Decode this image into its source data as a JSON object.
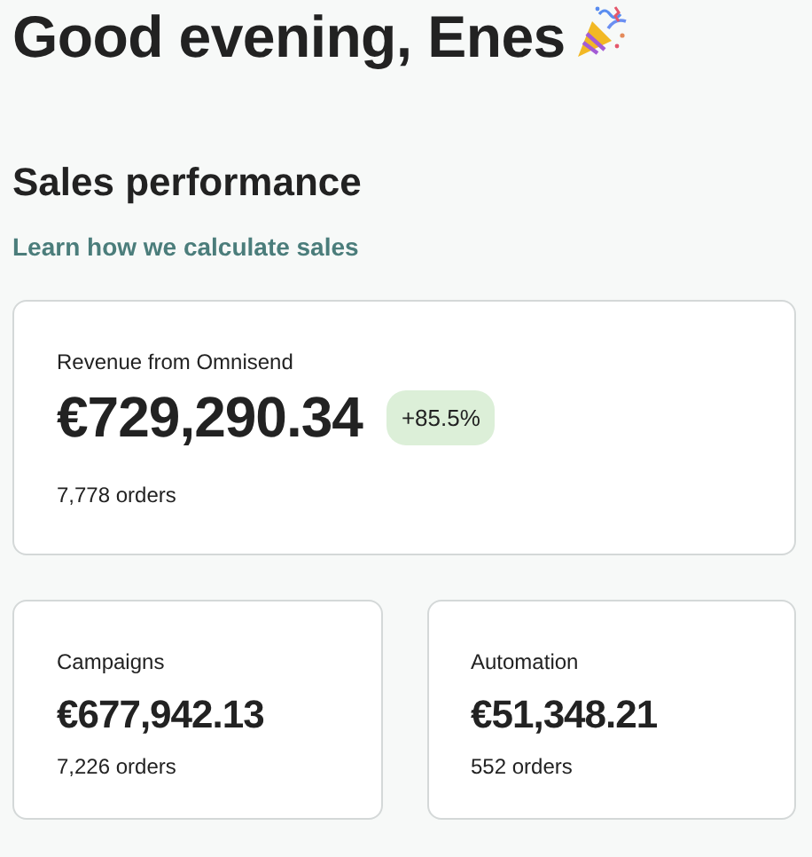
{
  "greeting": "Good evening, Enes",
  "section_title": "Sales performance",
  "learn_link": "Learn how we calculate sales",
  "total": {
    "label": "Revenue from Omnisend",
    "amount": "€729,290.34",
    "change": "+85.5%",
    "orders": "7,778 orders"
  },
  "breakdown": [
    {
      "label": "Campaigns",
      "amount": "€677,942.13",
      "orders": "7,226 orders"
    },
    {
      "label": "Automation",
      "amount": "€51,348.21",
      "orders": "552 orders"
    }
  ]
}
